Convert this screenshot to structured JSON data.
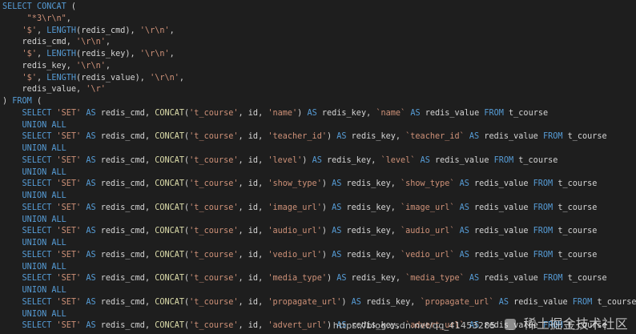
{
  "colors": {
    "background": "#1e1e1e",
    "keyword": "#569cd6",
    "function": "#dcdcaa",
    "string": "#ce9178",
    "identifier": "#d4d4d4"
  },
  "lines": [
    [
      [
        "k",
        "SELECT"
      ],
      [
        "w",
        " "
      ],
      [
        "k",
        "CONCAT"
      ],
      [
        "p",
        " ("
      ]
    ],
    [
      [
        "w",
        "     "
      ],
      [
        "s",
        "\"*3\\r\\n\""
      ],
      [
        "p",
        ","
      ]
    ],
    [
      [
        "w",
        "    "
      ],
      [
        "s",
        "'$'"
      ],
      [
        "p",
        ", "
      ],
      [
        "k",
        "LENGTH"
      ],
      [
        "p",
        "("
      ],
      [
        "i",
        "redis_cmd"
      ],
      [
        "p",
        "), "
      ],
      [
        "s",
        "'\\r\\n'"
      ],
      [
        "p",
        ","
      ]
    ],
    [
      [
        "w",
        "    "
      ],
      [
        "i",
        "redis_cmd"
      ],
      [
        "p",
        ", "
      ],
      [
        "s",
        "'\\r\\n'"
      ],
      [
        "p",
        ","
      ]
    ],
    [
      [
        "w",
        "    "
      ],
      [
        "s",
        "'$'"
      ],
      [
        "p",
        ", "
      ],
      [
        "k",
        "LENGTH"
      ],
      [
        "p",
        "("
      ],
      [
        "i",
        "redis_key"
      ],
      [
        "p",
        "), "
      ],
      [
        "s",
        "'\\r\\n'"
      ],
      [
        "p",
        ","
      ]
    ],
    [
      [
        "w",
        "    "
      ],
      [
        "i",
        "redis_key"
      ],
      [
        "p",
        ", "
      ],
      [
        "s",
        "'\\r\\n'"
      ],
      [
        "p",
        ","
      ]
    ],
    [
      [
        "w",
        "    "
      ],
      [
        "s",
        "'$'"
      ],
      [
        "p",
        ", "
      ],
      [
        "k",
        "LENGTH"
      ],
      [
        "p",
        "("
      ],
      [
        "i",
        "redis_value"
      ],
      [
        "p",
        "), "
      ],
      [
        "s",
        "'\\r\\n'"
      ],
      [
        "p",
        ","
      ]
    ],
    [
      [
        "w",
        "    "
      ],
      [
        "i",
        "redis_value"
      ],
      [
        "p",
        ", "
      ],
      [
        "s",
        "'\\r'"
      ]
    ],
    [
      [
        "p",
        ") "
      ],
      [
        "k",
        "FROM"
      ],
      [
        "p",
        " ("
      ]
    ],
    [
      [
        "w",
        "    "
      ],
      [
        "k",
        "SELECT"
      ],
      [
        "w",
        " "
      ],
      [
        "s",
        "'SET'"
      ],
      [
        "w",
        " "
      ],
      [
        "k",
        "AS"
      ],
      [
        "w",
        " "
      ],
      [
        "i",
        "redis_cmd"
      ],
      [
        "p",
        ", "
      ],
      [
        "f",
        "CONCAT"
      ],
      [
        "p",
        "("
      ],
      [
        "s",
        "'t_course'"
      ],
      [
        "p",
        ", "
      ],
      [
        "i",
        "id"
      ],
      [
        "p",
        ", "
      ],
      [
        "s",
        "'name'"
      ],
      [
        "p",
        ") "
      ],
      [
        "k",
        "AS"
      ],
      [
        "w",
        " "
      ],
      [
        "i",
        "redis_key"
      ],
      [
        "p",
        ", "
      ],
      [
        "s",
        "`name`"
      ],
      [
        "w",
        " "
      ],
      [
        "k",
        "AS"
      ],
      [
        "w",
        " "
      ],
      [
        "i",
        "redis_value"
      ],
      [
        "w",
        " "
      ],
      [
        "k",
        "FROM"
      ],
      [
        "w",
        " "
      ],
      [
        "i",
        "t_course"
      ]
    ],
    [
      [
        "w",
        "    "
      ],
      [
        "k",
        "UNION ALL"
      ]
    ],
    [
      [
        "w",
        "    "
      ],
      [
        "k",
        "SELECT"
      ],
      [
        "w",
        " "
      ],
      [
        "s",
        "'SET'"
      ],
      [
        "w",
        " "
      ],
      [
        "k",
        "AS"
      ],
      [
        "w",
        " "
      ],
      [
        "i",
        "redis_cmd"
      ],
      [
        "p",
        ", "
      ],
      [
        "f",
        "CONCAT"
      ],
      [
        "p",
        "("
      ],
      [
        "s",
        "'t_course'"
      ],
      [
        "p",
        ", "
      ],
      [
        "i",
        "id"
      ],
      [
        "p",
        ", "
      ],
      [
        "s",
        "'teacher_id'"
      ],
      [
        "p",
        ") "
      ],
      [
        "k",
        "AS"
      ],
      [
        "w",
        " "
      ],
      [
        "i",
        "redis_key"
      ],
      [
        "p",
        ", "
      ],
      [
        "s",
        "`teacher_id`"
      ],
      [
        "w",
        " "
      ],
      [
        "k",
        "AS"
      ],
      [
        "w",
        " "
      ],
      [
        "i",
        "redis_value"
      ],
      [
        "w",
        " "
      ],
      [
        "k",
        "FROM"
      ],
      [
        "w",
        " "
      ],
      [
        "i",
        "t_course"
      ]
    ],
    [
      [
        "w",
        "    "
      ],
      [
        "k",
        "UNION ALL"
      ]
    ],
    [
      [
        "w",
        "    "
      ],
      [
        "k",
        "SELECT"
      ],
      [
        "w",
        " "
      ],
      [
        "s",
        "'SET'"
      ],
      [
        "w",
        " "
      ],
      [
        "k",
        "AS"
      ],
      [
        "w",
        " "
      ],
      [
        "i",
        "redis_cmd"
      ],
      [
        "p",
        ", "
      ],
      [
        "f",
        "CONCAT"
      ],
      [
        "p",
        "("
      ],
      [
        "s",
        "'t_course'"
      ],
      [
        "p",
        ", "
      ],
      [
        "i",
        "id"
      ],
      [
        "p",
        ", "
      ],
      [
        "s",
        "'level'"
      ],
      [
        "p",
        ") "
      ],
      [
        "k",
        "AS"
      ],
      [
        "w",
        " "
      ],
      [
        "i",
        "redis_key"
      ],
      [
        "p",
        ", "
      ],
      [
        "s",
        "`level`"
      ],
      [
        "w",
        " "
      ],
      [
        "k",
        "AS"
      ],
      [
        "w",
        " "
      ],
      [
        "i",
        "redis_value"
      ],
      [
        "w",
        " "
      ],
      [
        "k",
        "FROM"
      ],
      [
        "w",
        " "
      ],
      [
        "i",
        "t_course"
      ]
    ],
    [
      [
        "w",
        "    "
      ],
      [
        "k",
        "UNION ALL"
      ]
    ],
    [
      [
        "w",
        "    "
      ],
      [
        "k",
        "SELECT"
      ],
      [
        "w",
        " "
      ],
      [
        "s",
        "'SET'"
      ],
      [
        "w",
        " "
      ],
      [
        "k",
        "AS"
      ],
      [
        "w",
        " "
      ],
      [
        "i",
        "redis_cmd"
      ],
      [
        "p",
        ", "
      ],
      [
        "f",
        "CONCAT"
      ],
      [
        "p",
        "("
      ],
      [
        "s",
        "'t_course'"
      ],
      [
        "p",
        ", "
      ],
      [
        "i",
        "id"
      ],
      [
        "p",
        ", "
      ],
      [
        "s",
        "'show_type'"
      ],
      [
        "p",
        ") "
      ],
      [
        "k",
        "AS"
      ],
      [
        "w",
        " "
      ],
      [
        "i",
        "redis_key"
      ],
      [
        "p",
        ", "
      ],
      [
        "s",
        "`show_type`"
      ],
      [
        "w",
        " "
      ],
      [
        "k",
        "AS"
      ],
      [
        "w",
        " "
      ],
      [
        "i",
        "redis_value"
      ],
      [
        "w",
        " "
      ],
      [
        "k",
        "FROM"
      ],
      [
        "w",
        " "
      ],
      [
        "i",
        "t_course"
      ]
    ],
    [
      [
        "w",
        "    "
      ],
      [
        "k",
        "UNION ALL"
      ]
    ],
    [
      [
        "w",
        "    "
      ],
      [
        "k",
        "SELECT"
      ],
      [
        "w",
        " "
      ],
      [
        "s",
        "'SET'"
      ],
      [
        "w",
        " "
      ],
      [
        "k",
        "AS"
      ],
      [
        "w",
        " "
      ],
      [
        "i",
        "redis_cmd"
      ],
      [
        "p",
        ", "
      ],
      [
        "f",
        "CONCAT"
      ],
      [
        "p",
        "("
      ],
      [
        "s",
        "'t_course'"
      ],
      [
        "p",
        ", "
      ],
      [
        "i",
        "id"
      ],
      [
        "p",
        ", "
      ],
      [
        "s",
        "'image_url'"
      ],
      [
        "p",
        ") "
      ],
      [
        "k",
        "AS"
      ],
      [
        "w",
        " "
      ],
      [
        "i",
        "redis_key"
      ],
      [
        "p",
        ", "
      ],
      [
        "s",
        "`image_url`"
      ],
      [
        "w",
        " "
      ],
      [
        "k",
        "AS"
      ],
      [
        "w",
        " "
      ],
      [
        "i",
        "redis_value"
      ],
      [
        "w",
        " "
      ],
      [
        "k",
        "FROM"
      ],
      [
        "w",
        " "
      ],
      [
        "i",
        "t_course"
      ]
    ],
    [
      [
        "w",
        "    "
      ],
      [
        "k",
        "UNION ALL"
      ]
    ],
    [
      [
        "w",
        "    "
      ],
      [
        "k",
        "SELECT"
      ],
      [
        "w",
        " "
      ],
      [
        "s",
        "'SET'"
      ],
      [
        "w",
        " "
      ],
      [
        "k",
        "AS"
      ],
      [
        "w",
        " "
      ],
      [
        "i",
        "redis_cmd"
      ],
      [
        "p",
        ", "
      ],
      [
        "f",
        "CONCAT"
      ],
      [
        "p",
        "("
      ],
      [
        "s",
        "'t_course'"
      ],
      [
        "p",
        ", "
      ],
      [
        "i",
        "id"
      ],
      [
        "p",
        ", "
      ],
      [
        "s",
        "'audio_url'"
      ],
      [
        "p",
        ") "
      ],
      [
        "k",
        "AS"
      ],
      [
        "w",
        " "
      ],
      [
        "i",
        "redis_key"
      ],
      [
        "p",
        ", "
      ],
      [
        "s",
        "`audio_url`"
      ],
      [
        "w",
        " "
      ],
      [
        "k",
        "AS"
      ],
      [
        "w",
        " "
      ],
      [
        "i",
        "redis_value"
      ],
      [
        "w",
        " "
      ],
      [
        "k",
        "FROM"
      ],
      [
        "w",
        " "
      ],
      [
        "i",
        "t_course"
      ]
    ],
    [
      [
        "w",
        "    "
      ],
      [
        "k",
        "UNION ALL"
      ]
    ],
    [
      [
        "w",
        "    "
      ],
      [
        "k",
        "SELECT"
      ],
      [
        "w",
        " "
      ],
      [
        "s",
        "'SET'"
      ],
      [
        "w",
        " "
      ],
      [
        "k",
        "AS"
      ],
      [
        "w",
        " "
      ],
      [
        "i",
        "redis_cmd"
      ],
      [
        "p",
        ", "
      ],
      [
        "f",
        "CONCAT"
      ],
      [
        "p",
        "("
      ],
      [
        "s",
        "'t_course'"
      ],
      [
        "p",
        ", "
      ],
      [
        "i",
        "id"
      ],
      [
        "p",
        ", "
      ],
      [
        "s",
        "'vedio_url'"
      ],
      [
        "p",
        ") "
      ],
      [
        "k",
        "AS"
      ],
      [
        "w",
        " "
      ],
      [
        "i",
        "redis_key"
      ],
      [
        "p",
        ", "
      ],
      [
        "s",
        "`vedio_url`"
      ],
      [
        "w",
        " "
      ],
      [
        "k",
        "AS"
      ],
      [
        "w",
        " "
      ],
      [
        "i",
        "redis_value"
      ],
      [
        "w",
        " "
      ],
      [
        "k",
        "FROM"
      ],
      [
        "w",
        " "
      ],
      [
        "i",
        "t_course"
      ]
    ],
    [
      [
        "w",
        "    "
      ],
      [
        "k",
        "UNION ALL"
      ]
    ],
    [
      [
        "w",
        "    "
      ],
      [
        "k",
        "SELECT"
      ],
      [
        "w",
        " "
      ],
      [
        "s",
        "'SET'"
      ],
      [
        "w",
        " "
      ],
      [
        "k",
        "AS"
      ],
      [
        "w",
        " "
      ],
      [
        "i",
        "redis_cmd"
      ],
      [
        "p",
        ", "
      ],
      [
        "f",
        "CONCAT"
      ],
      [
        "p",
        "("
      ],
      [
        "s",
        "'t_course'"
      ],
      [
        "p",
        ", "
      ],
      [
        "i",
        "id"
      ],
      [
        "p",
        ", "
      ],
      [
        "s",
        "'media_type'"
      ],
      [
        "p",
        ") "
      ],
      [
        "k",
        "AS"
      ],
      [
        "w",
        " "
      ],
      [
        "i",
        "redis_key"
      ],
      [
        "p",
        ", "
      ],
      [
        "s",
        "`media_type`"
      ],
      [
        "w",
        " "
      ],
      [
        "k",
        "AS"
      ],
      [
        "w",
        " "
      ],
      [
        "i",
        "redis_value"
      ],
      [
        "w",
        " "
      ],
      [
        "k",
        "FROM"
      ],
      [
        "w",
        " "
      ],
      [
        "i",
        "t_course"
      ]
    ],
    [
      [
        "w",
        "    "
      ],
      [
        "k",
        "UNION ALL"
      ]
    ],
    [
      [
        "w",
        "    "
      ],
      [
        "k",
        "SELECT"
      ],
      [
        "w",
        " "
      ],
      [
        "s",
        "'SET'"
      ],
      [
        "w",
        " "
      ],
      [
        "k",
        "AS"
      ],
      [
        "w",
        " "
      ],
      [
        "i",
        "redis_cmd"
      ],
      [
        "p",
        ", "
      ],
      [
        "f",
        "CONCAT"
      ],
      [
        "p",
        "("
      ],
      [
        "s",
        "'t_course'"
      ],
      [
        "p",
        ", "
      ],
      [
        "i",
        "id"
      ],
      [
        "p",
        ", "
      ],
      [
        "s",
        "'propagate_url'"
      ],
      [
        "p",
        ") "
      ],
      [
        "k",
        "AS"
      ],
      [
        "w",
        " "
      ],
      [
        "i",
        "redis_key"
      ],
      [
        "p",
        ", "
      ],
      [
        "s",
        "`propagate_url`"
      ],
      [
        "w",
        " "
      ],
      [
        "k",
        "AS"
      ],
      [
        "w",
        " "
      ],
      [
        "i",
        "redis_value"
      ],
      [
        "w",
        " "
      ],
      [
        "k",
        "FROM"
      ],
      [
        "w",
        " "
      ],
      [
        "i",
        "t_course"
      ]
    ],
    [
      [
        "w",
        "    "
      ],
      [
        "k",
        "UNION ALL"
      ]
    ],
    [
      [
        "w",
        "    "
      ],
      [
        "k",
        "SELECT"
      ],
      [
        "w",
        " "
      ],
      [
        "s",
        "'SET'"
      ],
      [
        "w",
        " "
      ],
      [
        "k",
        "AS"
      ],
      [
        "w",
        " "
      ],
      [
        "i",
        "redis_cmd"
      ],
      [
        "p",
        ", "
      ],
      [
        "f",
        "CONCAT"
      ],
      [
        "p",
        "("
      ],
      [
        "s",
        "'t_course'"
      ],
      [
        "p",
        ", "
      ],
      [
        "i",
        "id"
      ],
      [
        "p",
        ", "
      ],
      [
        "s",
        "'advert_url'"
      ],
      [
        "p",
        ") "
      ],
      [
        "k",
        "AS"
      ],
      [
        "w",
        " "
      ],
      [
        "i",
        "redis_key"
      ],
      [
        "p",
        ", "
      ],
      [
        "s",
        "`advert_url`"
      ],
      [
        "w",
        " "
      ],
      [
        "k",
        "AS"
      ],
      [
        "w",
        " "
      ],
      [
        "i",
        "redis_value"
      ],
      [
        "w",
        " "
      ],
      [
        "k",
        "FROM"
      ],
      [
        "w",
        " "
      ],
      [
        "i",
        "t_course"
      ]
    ]
  ],
  "watermark": {
    "url": "https://blog.csdn.net/qq_41453285",
    "logo_icon": "juejin-logo-icon",
    "site": "稀土掘金技术社区"
  }
}
